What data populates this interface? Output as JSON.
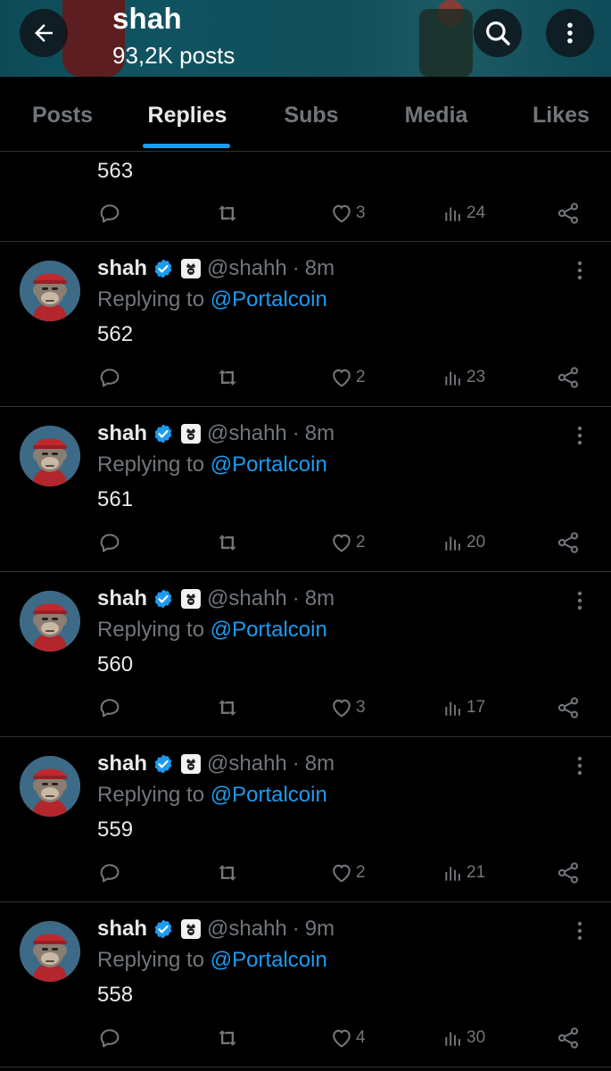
{
  "header": {
    "name": "shah",
    "posts_count": "93,2K posts",
    "back_icon": "arrow-left-icon",
    "search_icon": "search-icon",
    "more_icon": "more-vertical-icon"
  },
  "tabs": [
    {
      "label": "Posts",
      "active": false
    },
    {
      "label": "Replies",
      "active": true
    },
    {
      "label": "Subs",
      "active": false
    },
    {
      "label": "Media",
      "active": false
    },
    {
      "label": "Likes",
      "active": false
    }
  ],
  "partial_post": {
    "text": "563",
    "likes": "3",
    "views": "24"
  },
  "replying_label": "Replying to",
  "posts": [
    {
      "name": "shah",
      "handle": "@shahh",
      "time": "8m",
      "mention": "@Portalcoin",
      "text": "562",
      "likes": "2",
      "views": "23"
    },
    {
      "name": "shah",
      "handle": "@shahh",
      "time": "8m",
      "mention": "@Portalcoin",
      "text": "561",
      "likes": "2",
      "views": "20"
    },
    {
      "name": "shah",
      "handle": "@shahh",
      "time": "8m",
      "mention": "@Portalcoin",
      "text": "560",
      "likes": "3",
      "views": "17"
    },
    {
      "name": "shah",
      "handle": "@shahh",
      "time": "8m",
      "mention": "@Portalcoin",
      "text": "559",
      "likes": "2",
      "views": "21"
    },
    {
      "name": "shah",
      "handle": "@shahh",
      "time": "9m",
      "mention": "@Portalcoin",
      "text": "558",
      "likes": "4",
      "views": "30"
    }
  ],
  "colors": {
    "background": "#000000",
    "accent": "#1d9bf0",
    "muted_text": "#71767b",
    "divider": "#2f3336"
  }
}
